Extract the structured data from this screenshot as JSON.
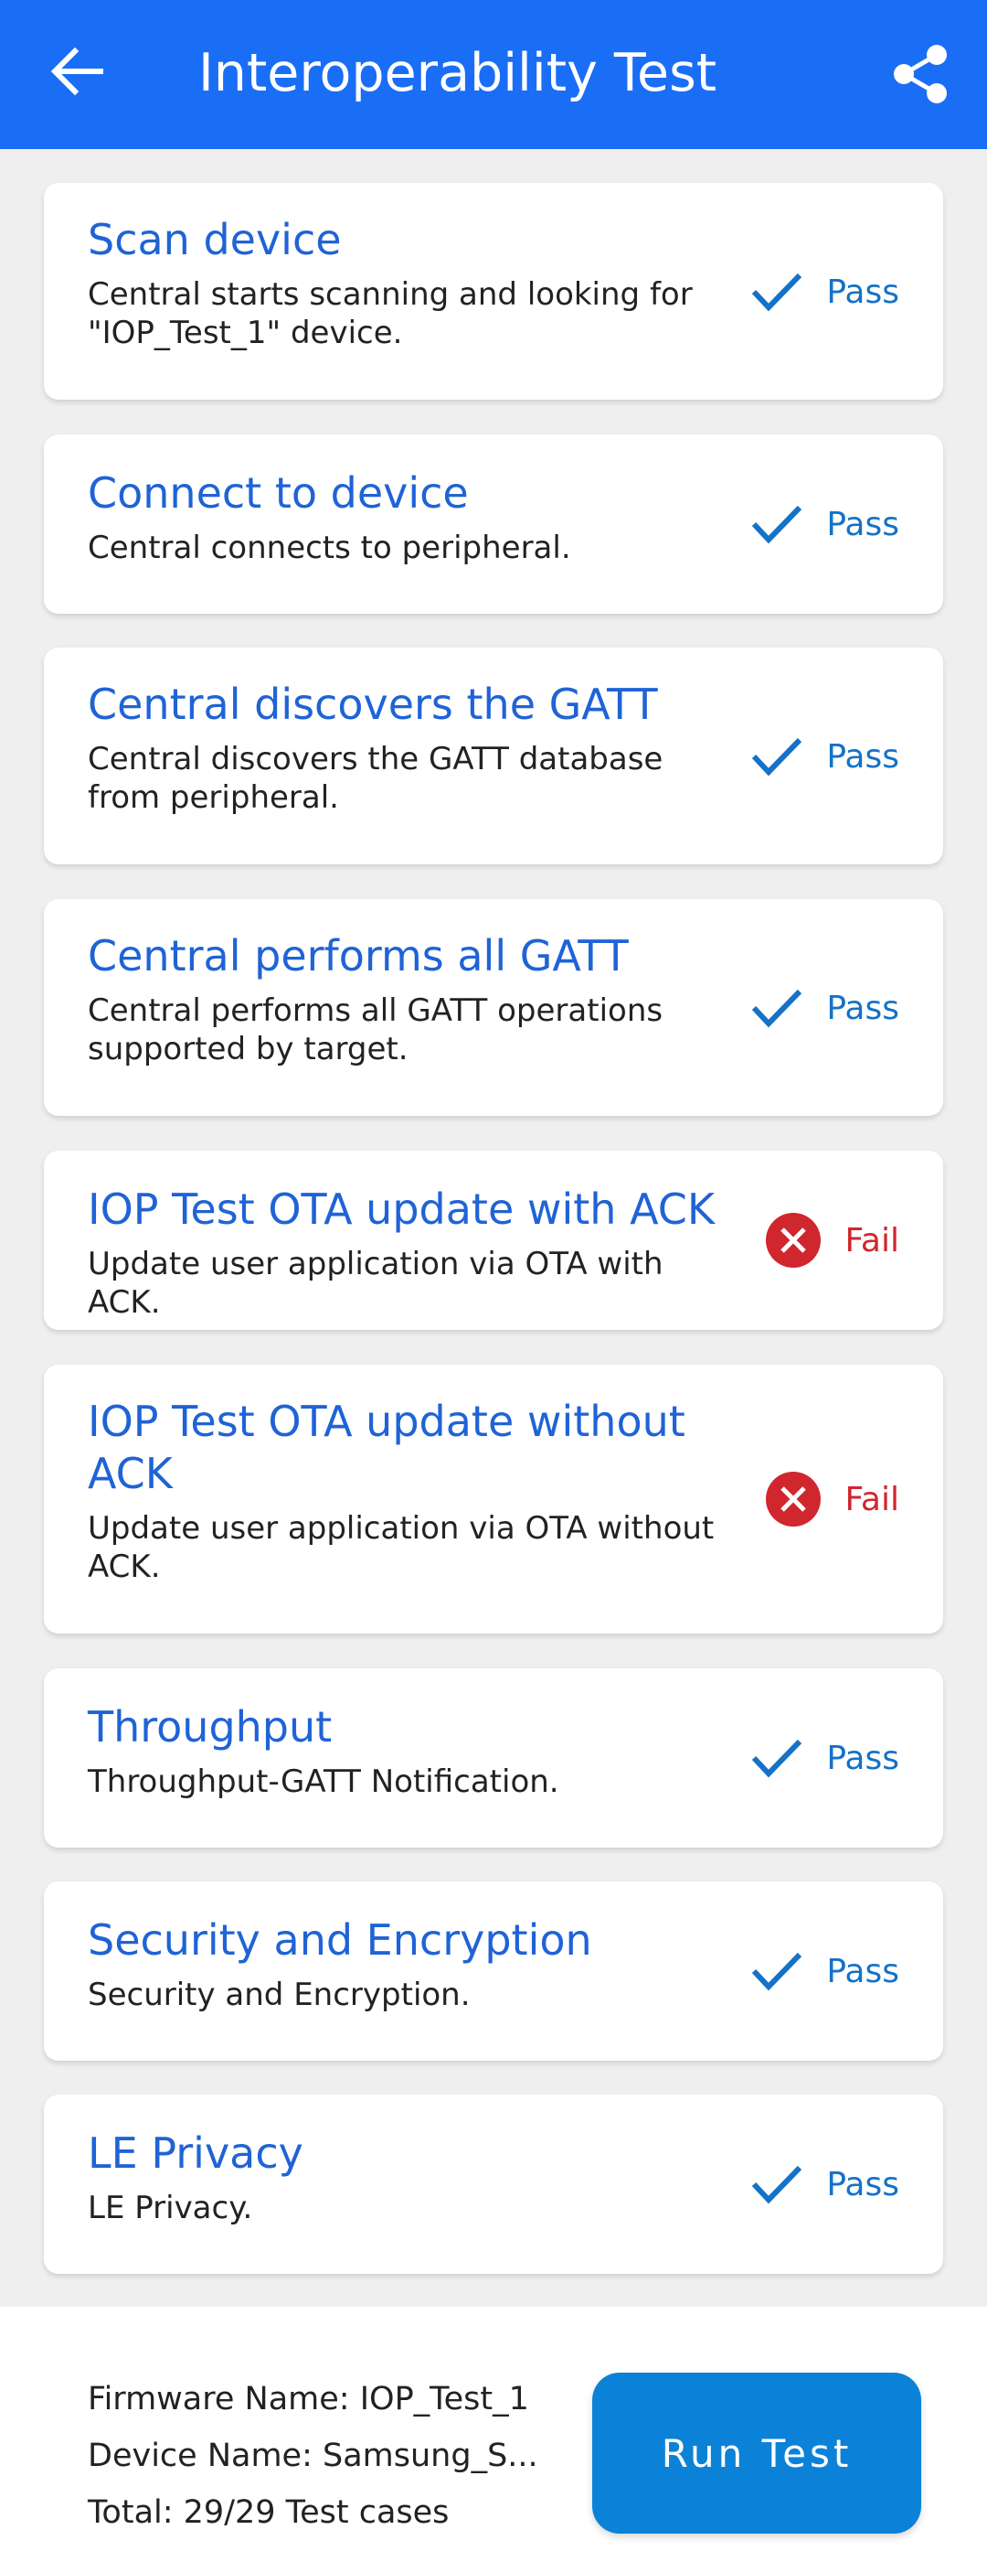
{
  "app_bar": {
    "title": "Interoperability Test",
    "back_icon": "arrow-left-icon",
    "share_icon": "share-icon"
  },
  "tests": [
    {
      "title": "Scan device",
      "description": "Central starts scanning and looking for \"IOP_Test_1\" device.",
      "status": "Pass"
    },
    {
      "title": "Connect to device",
      "description": "Central connects to peripheral.",
      "status": "Pass"
    },
    {
      "title": "Central discovers the GATT",
      "description": "Central discovers the GATT database from peripheral.",
      "status": "Pass"
    },
    {
      "title": "Central performs all GATT",
      "description": "Central performs all GATT operations supported by target.",
      "status": "Pass"
    },
    {
      "title": "IOP Test OTA update with ACK",
      "description": "Update user application via OTA with ACK.",
      "status": "Fail"
    },
    {
      "title": "IOP Test OTA update without ACK",
      "description": "Update user application via OTA without ACK.",
      "status": "Fail"
    },
    {
      "title": "Throughput",
      "description": "Throughput-GATT Notification.",
      "status": "Pass"
    },
    {
      "title": "Security and Encryption",
      "description": "Security and Encryption.",
      "status": "Pass"
    },
    {
      "title": "LE Privacy",
      "description": "LE Privacy.",
      "status": "Pass"
    }
  ],
  "footer": {
    "firmware_name": "Firmware Name: IOP_Test_1",
    "device_name": "Device Name: Samsung_S...",
    "total": "Total: 29/29 Test cases",
    "run_button": "Run Test"
  },
  "colors": {
    "app_bar": "#1a6ef5",
    "card_title": "#1f63d6",
    "pass": "#1472c7",
    "fail": "#d0262e",
    "run_button": "#0b82d8"
  }
}
